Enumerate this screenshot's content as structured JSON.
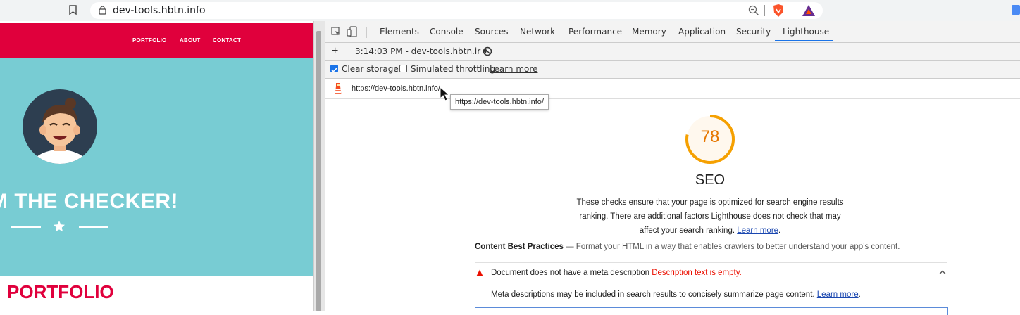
{
  "browser": {
    "url": "dev-tools.hbtn.info",
    "icons": [
      "bookmark-icon",
      "lock-icon",
      "zoom-icon",
      "brave-shield-icon",
      "brave-rewards-icon",
      "extension-icon"
    ]
  },
  "page": {
    "nav": [
      "PORTFOLIO",
      "ABOUT",
      "CONTACT"
    ],
    "hero_title": "M THE CHECKER!",
    "section_title": "PORTFOLIO",
    "colors": {
      "nav_bg": "#e0003c",
      "hero_bg": "#78ccd3",
      "accent": "#e0003c"
    }
  },
  "devtools": {
    "tabs": [
      "Elements",
      "Console",
      "Sources",
      "Network",
      "Performance",
      "Memory",
      "Application",
      "Security",
      "Lighthouse"
    ],
    "active_tab": "Lighthouse",
    "report_select": "3:14:03 PM - dev-tools.hbtn.ir ▾",
    "options": {
      "clear_storage": "Clear storage",
      "clear_storage_checked": true,
      "throttling": "Simulated throttling",
      "throttling_checked": false,
      "learn_more": "Learn more"
    },
    "audited_url": "https://dev-tools.hbtn.info/",
    "tooltip": "https://dev-tools.hbtn.info/"
  },
  "report": {
    "score": "78",
    "score_color": "#e67700",
    "category": "SEO",
    "description": "These checks ensure that your page is optimized for search engine results ranking. There are additional factors Lighthouse does not check that may affect your search ranking. ",
    "description_link": "Learn more",
    "group_title": "Content Best Practices",
    "group_desc": " — Format your HTML in a way that enables crawlers to better understand your app’s content.",
    "audit": {
      "title": "Document does not have a meta description",
      "fail_text": "Description text is empty.",
      "description": "Meta descriptions may be included in search results to concisely summarize page content. ",
      "link": "Learn more"
    }
  }
}
